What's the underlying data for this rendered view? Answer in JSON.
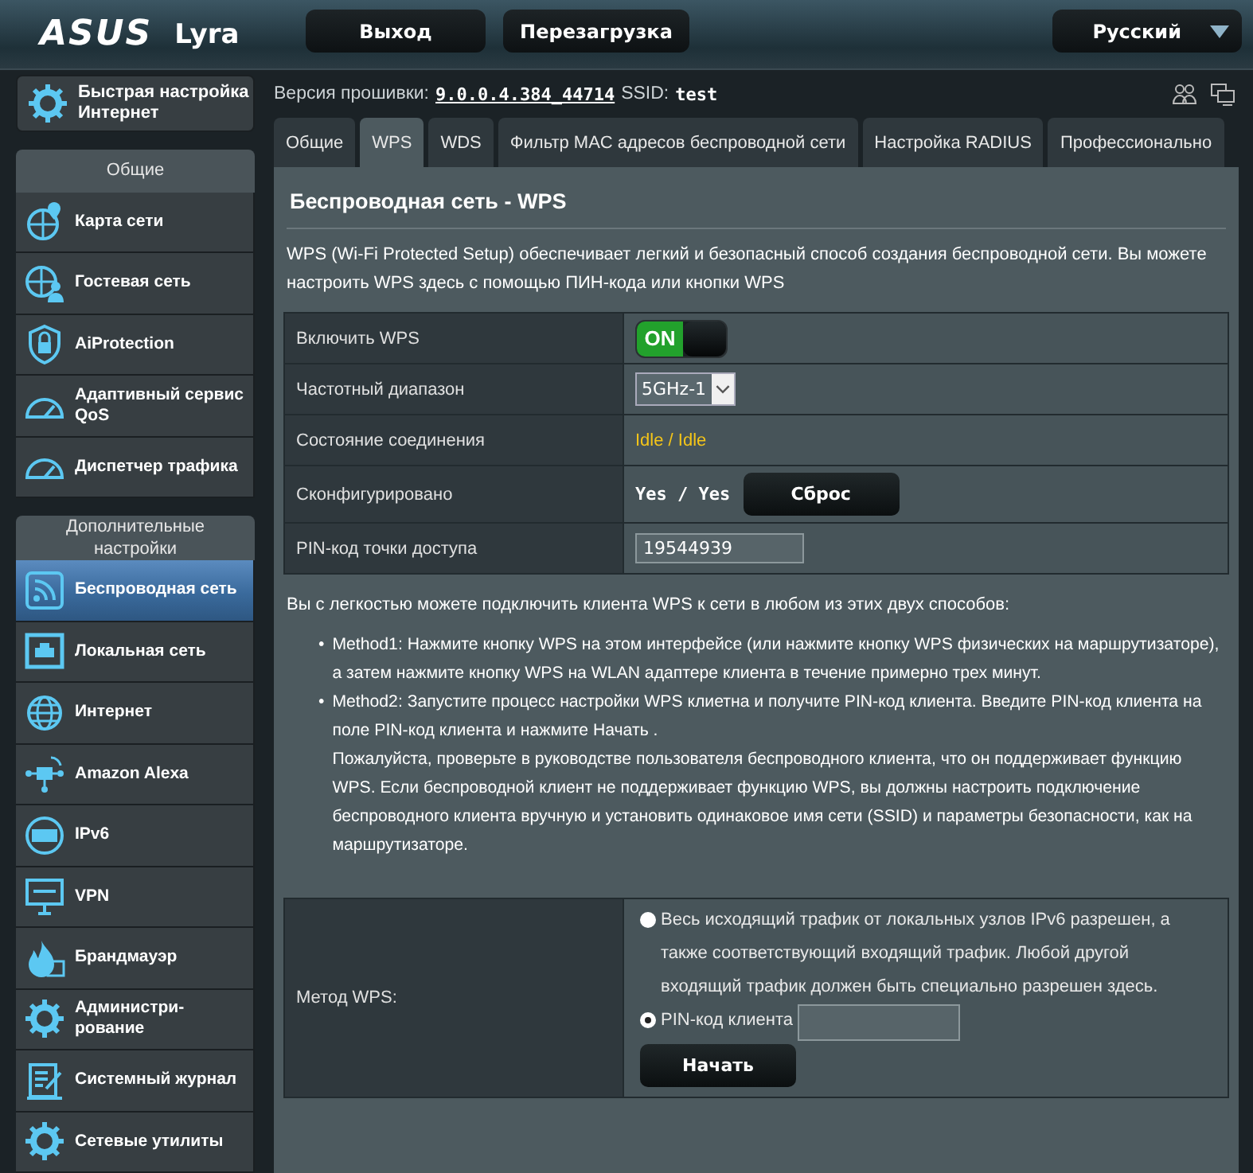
{
  "header": {
    "logo": "ASUS",
    "model": "Lyra",
    "buttons": [
      "Выход",
      "Перезагрузка"
    ],
    "language": "Русский"
  },
  "quick_setup": "Быстрая настройка Интернет",
  "sidebar": {
    "sections": [
      {
        "title": "Общие",
        "items": [
          {
            "label": "Карта сети",
            "selected": false
          },
          {
            "label": "Гостевая сеть",
            "selected": false
          },
          {
            "label": "AiProtection",
            "selected": false
          },
          {
            "label": "Адаптивный сервис QoS",
            "selected": false
          },
          {
            "label": "Диспетчер трафика",
            "selected": false
          }
        ]
      },
      {
        "title": "Дополнительные настройки",
        "items": [
          {
            "label": "Беспроводная сеть",
            "selected": true
          },
          {
            "label": "Локальная сеть",
            "selected": false
          },
          {
            "label": "Интернет",
            "selected": false
          },
          {
            "label": "Amazon Alexa",
            "selected": false
          },
          {
            "label": "IPv6",
            "selected": false
          },
          {
            "label": "VPN",
            "selected": false
          },
          {
            "label": "Брандмауэр",
            "selected": false
          },
          {
            "label": "Администри-рование",
            "selected": false
          },
          {
            "label": "Системный журнал",
            "selected": false
          },
          {
            "label": "Сетевые утилиты",
            "selected": false
          }
        ]
      }
    ]
  },
  "firmware": {
    "label": "Версия прошивки:",
    "version": "9.0.0.4.384_44714",
    "ssid_label": "SSID:",
    "ssid": "test"
  },
  "tabs": [
    {
      "label": "Общие",
      "selected": false
    },
    {
      "label": "WPS",
      "selected": true
    },
    {
      "label": "WDS",
      "selected": false
    },
    {
      "label": "Фильтр MAC адресов беспроводной сети",
      "selected": false
    },
    {
      "label": "Настройка RADIUS",
      "selected": false
    },
    {
      "label": "Профессионально",
      "selected": false
    }
  ],
  "page": {
    "title": "Беспроводная сеть - WPS",
    "description": "WPS (Wi-Fi Protected Setup) обеспечивает легкий и безопасный способ создания беспроводной сети. Вы можете настроить WPS здесь с помощью ПИН-кода или кнопки WPS",
    "settings": [
      {
        "kind": "toggle",
        "label": "Включить WPS",
        "on": true,
        "text": "ON"
      },
      {
        "kind": "select",
        "label": "Частотный диапазон",
        "value": "5GHz-1"
      },
      {
        "kind": "status",
        "label": "Состояние соединения",
        "value": "Idle / Idle"
      },
      {
        "kind": "configured",
        "label": "Сконфигурировано",
        "value": "Yes / Yes",
        "button": "Сброс"
      },
      {
        "kind": "input",
        "label": "PIN-код точки доступа",
        "value": "19544939"
      }
    ],
    "intro": "Вы с легкостью можете подключить клиента WPS к сети в любом из этих двух способов:",
    "methods": [
      {
        "marker": "•",
        "text": "Method1: Нажмите кнопку WPS на этом интерфейсе (или нажмите кнопку WPS физических на маршрутизаторе), а затем нажмите кнопку WPS на WLAN адаптере клиента в течение примерно трех минут."
      },
      {
        "marker": "•",
        "text": "Method2: Запустите процесс настройки WPS клиетна и получите PIN-код клиента. Введите PIN-код клиента на поле PIN-код клиента и нажмите Начать .",
        "note": "Пожалуйста, проверьте в руководстве пользователя беспроводного клиента, что он поддерживает функцию WPS. Если беспроводной клиент не поддерживает функцию WPS, вы должны настроить подключение беспроводного клиента вручную и установить одинаковое имя сети (SSID) и параметры безопасности, как на маршрутизаторе."
      }
    ],
    "wps_method": {
      "label": "Метод WPS:",
      "options": [
        {
          "label": "Весь исходящий трафик от локальных узлов IPv6 разрешен, а также соответствующий входящий трафик. Любой другой входящий трафик должен быть специально разрешен здесь.",
          "selected": false
        },
        {
          "label": "PIN-код клиента",
          "selected": true
        }
      ],
      "button": "Начать"
    }
  }
}
